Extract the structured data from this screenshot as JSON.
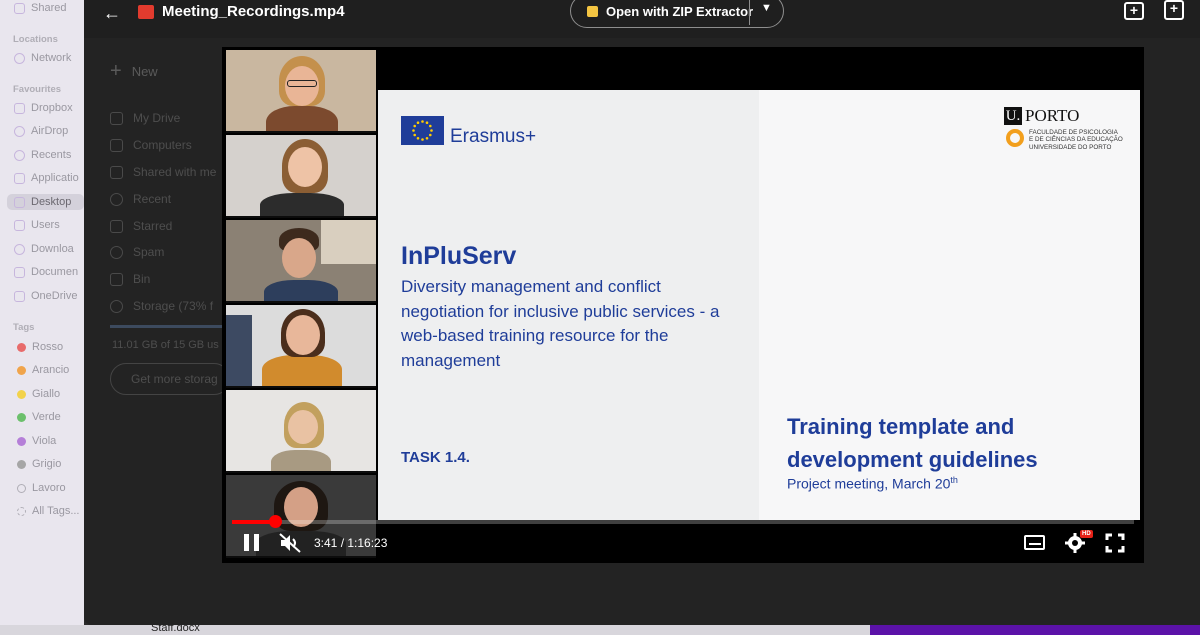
{
  "finder": {
    "shared": "Shared",
    "locations_header": "Locations",
    "network": "Network",
    "favourites_header": "Favourites",
    "favourites": [
      "Dropbox",
      "AirDrop",
      "Recents",
      "Applicatio",
      "Desktop",
      "Users",
      "Downloa",
      "Documen",
      "OneDrive"
    ],
    "tags_header": "Tags",
    "tags": [
      {
        "label": "Rosso",
        "color": "#e86b6b"
      },
      {
        "label": "Arancio",
        "color": "#f0a44b"
      },
      {
        "label": "Giallo",
        "color": "#f2d24a"
      },
      {
        "label": "Verde",
        "color": "#6cc06c"
      },
      {
        "label": "Viola",
        "color": "#b57fd8"
      },
      {
        "label": "Grigio",
        "color": "#a6a6a6"
      },
      {
        "label": "Lavoro",
        "color": "transparent"
      },
      {
        "label": "All Tags...",
        "color": "transparent"
      }
    ]
  },
  "drive": {
    "new_label": "New",
    "nav": [
      "My Drive",
      "Computers",
      "Shared with me",
      "Recent",
      "Starred",
      "Spam",
      "Bin",
      "Storage (73% f"
    ],
    "storage_text": "11.01 GB of 15 GB us",
    "get_storage": "Get more storag"
  },
  "viewer": {
    "file_title": "Meeting_Recordings.mp4",
    "open_with": "Open with ZIP Extractor"
  },
  "slide": {
    "erasmus": "Erasmus+",
    "uporto_u": "U.",
    "uporto_word": "PORTO",
    "uporto_sub": [
      "FACULDADE DE PSICOLOGIA",
      "E DE CIÊNCIAS DA EDUCAÇÃO",
      "UNIVERSIDADE DO PORTO"
    ],
    "title": "InPluServ",
    "description": "Diversity management and conflict negotiation for inclusive public services - a web-based training resource for the management",
    "task": "TASK 1.4.",
    "training": "Training template and development guidelines",
    "meeting": "Project meeting, March 20",
    "meeting_sup": "th"
  },
  "player": {
    "time": "3:41 / 1:16:23",
    "progress_fraction": 0.048,
    "hd": "HD"
  },
  "taskbar": {
    "staff": "Staff.docx"
  },
  "colors": {
    "slide_blue": "#1f3d99",
    "progress_red": "#ff0000",
    "uporto_orange": "#f29f1d"
  }
}
